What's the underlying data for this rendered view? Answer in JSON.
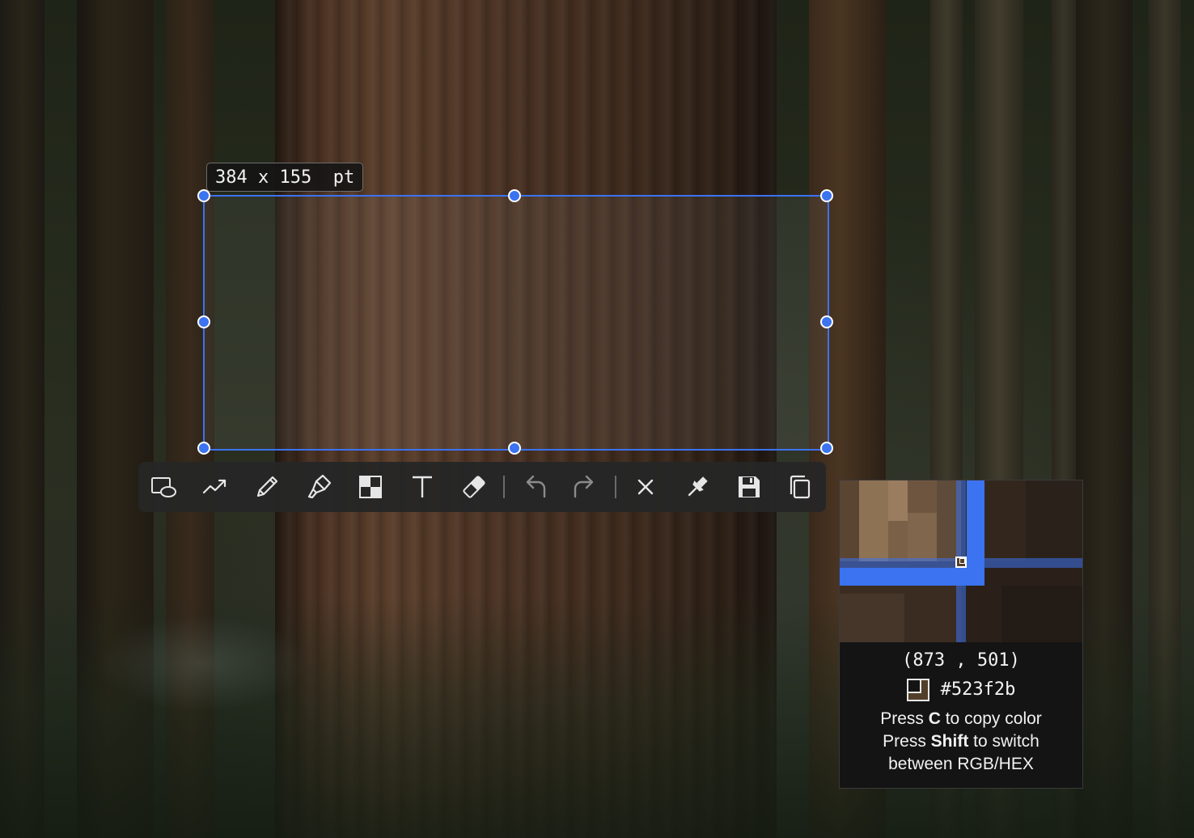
{
  "selection": {
    "size_width": "384",
    "size_sep": "x",
    "size_height": "155",
    "size_unit": "pt"
  },
  "toolbar": {
    "tools": [
      {
        "name": "rectangle-ellipse-tool",
        "icon": "shapes-icon"
      },
      {
        "name": "arrow-tool",
        "icon": "arrow-line-icon"
      },
      {
        "name": "pencil-tool",
        "icon": "pencil-icon"
      },
      {
        "name": "highlighter-tool",
        "icon": "marker-icon"
      },
      {
        "name": "mosaic-tool",
        "icon": "mosaic-icon"
      },
      {
        "name": "text-tool",
        "icon": "text-icon"
      },
      {
        "name": "eraser-tool",
        "icon": "eraser-icon"
      },
      {
        "name": "undo-button",
        "icon": "undo-icon"
      },
      {
        "name": "redo-button",
        "icon": "redo-icon"
      },
      {
        "name": "cancel-button",
        "icon": "close-icon"
      },
      {
        "name": "pin-button",
        "icon": "pin-icon"
      },
      {
        "name": "save-button",
        "icon": "floppy-disk-icon"
      },
      {
        "name": "copy-button",
        "icon": "copy-icon"
      }
    ]
  },
  "magnifier": {
    "coord_x": "873",
    "coord_sep": ",",
    "coord_y": "501",
    "color_hex": "#523f2b",
    "hint_1_pre": "Press ",
    "hint_1_key": "C",
    "hint_1_post": " to copy color",
    "hint_2_pre": "Press ",
    "hint_2_key": "Shift",
    "hint_2_post": " to switch",
    "hint_3": "between RGB/HEX"
  },
  "colors": {
    "accent": "#3b73f0",
    "toolbar_bg": "#262626",
    "picked": "#523f2b"
  }
}
